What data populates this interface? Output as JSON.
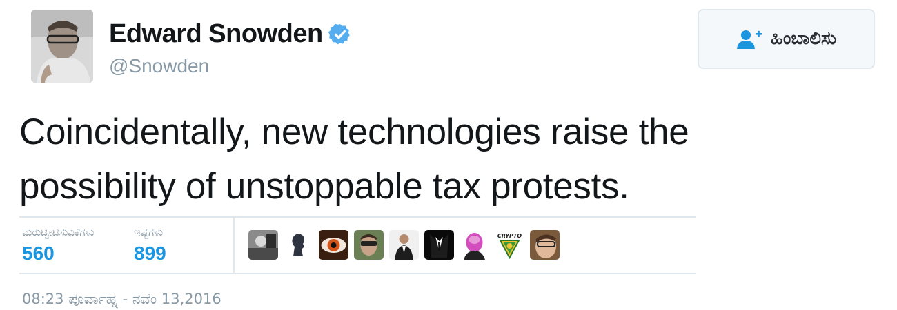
{
  "author": {
    "display_name": "Edward Snowden",
    "handle": "@Snowden",
    "verified_icon": "verified-badge-icon"
  },
  "follow_button": {
    "label": "ಹಿಂಬಾಲಿಸು",
    "icon": "add-user-icon"
  },
  "tweet": {
    "text": "Coincidentally, new technologies raise the possibility of unstoppable tax protests."
  },
  "stats": {
    "retweets_label": "ಮರುಟ್ವೀಟಿಸುವಿಕೆಗಳು",
    "retweets_value": "560",
    "likes_label": "ಇಷ್ಟಗಳು",
    "likes_value": "899"
  },
  "likers": [
    {
      "icon": "user-avatar-icon"
    },
    {
      "icon": "user-avatar-icon"
    },
    {
      "icon": "user-avatar-icon"
    },
    {
      "icon": "user-avatar-icon"
    },
    {
      "icon": "user-avatar-icon"
    },
    {
      "icon": "user-avatar-icon"
    },
    {
      "icon": "user-avatar-icon"
    },
    {
      "icon": "crypto-logo-icon",
      "text": "CRYPTO"
    },
    {
      "icon": "user-avatar-icon"
    }
  ],
  "timestamp": "08:23 ಪೂರ್ವಾಹ್ನ - ನವೆಂ 13,2016",
  "colors": {
    "link_blue": "#1b95e0",
    "muted_gray": "#8899a6",
    "verified_blue": "#55acee",
    "divider": "#e1e8ed"
  }
}
